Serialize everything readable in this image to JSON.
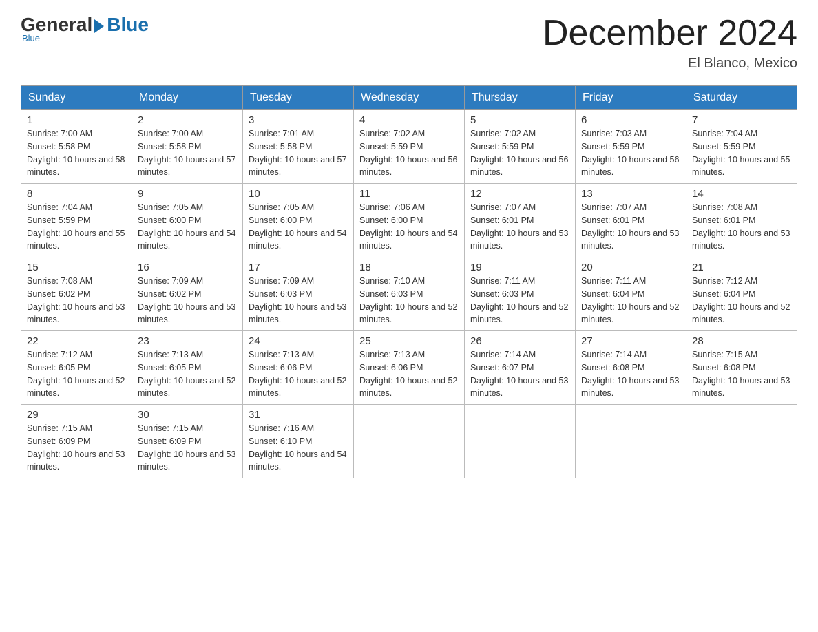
{
  "logo": {
    "general": "General",
    "blue": "Blue",
    "tagline": "Blue"
  },
  "title": {
    "month_year": "December 2024",
    "location": "El Blanco, Mexico"
  },
  "header_days": [
    "Sunday",
    "Monday",
    "Tuesday",
    "Wednesday",
    "Thursday",
    "Friday",
    "Saturday"
  ],
  "weeks": [
    [
      {
        "day": "1",
        "sunrise": "7:00 AM",
        "sunset": "5:58 PM",
        "daylight": "10 hours and 58 minutes."
      },
      {
        "day": "2",
        "sunrise": "7:00 AM",
        "sunset": "5:58 PM",
        "daylight": "10 hours and 57 minutes."
      },
      {
        "day": "3",
        "sunrise": "7:01 AM",
        "sunset": "5:58 PM",
        "daylight": "10 hours and 57 minutes."
      },
      {
        "day": "4",
        "sunrise": "7:02 AM",
        "sunset": "5:59 PM",
        "daylight": "10 hours and 56 minutes."
      },
      {
        "day": "5",
        "sunrise": "7:02 AM",
        "sunset": "5:59 PM",
        "daylight": "10 hours and 56 minutes."
      },
      {
        "day": "6",
        "sunrise": "7:03 AM",
        "sunset": "5:59 PM",
        "daylight": "10 hours and 56 minutes."
      },
      {
        "day": "7",
        "sunrise": "7:04 AM",
        "sunset": "5:59 PM",
        "daylight": "10 hours and 55 minutes."
      }
    ],
    [
      {
        "day": "8",
        "sunrise": "7:04 AM",
        "sunset": "5:59 PM",
        "daylight": "10 hours and 55 minutes."
      },
      {
        "day": "9",
        "sunrise": "7:05 AM",
        "sunset": "6:00 PM",
        "daylight": "10 hours and 54 minutes."
      },
      {
        "day": "10",
        "sunrise": "7:05 AM",
        "sunset": "6:00 PM",
        "daylight": "10 hours and 54 minutes."
      },
      {
        "day": "11",
        "sunrise": "7:06 AM",
        "sunset": "6:00 PM",
        "daylight": "10 hours and 54 minutes."
      },
      {
        "day": "12",
        "sunrise": "7:07 AM",
        "sunset": "6:01 PM",
        "daylight": "10 hours and 53 minutes."
      },
      {
        "day": "13",
        "sunrise": "7:07 AM",
        "sunset": "6:01 PM",
        "daylight": "10 hours and 53 minutes."
      },
      {
        "day": "14",
        "sunrise": "7:08 AM",
        "sunset": "6:01 PM",
        "daylight": "10 hours and 53 minutes."
      }
    ],
    [
      {
        "day": "15",
        "sunrise": "7:08 AM",
        "sunset": "6:02 PM",
        "daylight": "10 hours and 53 minutes."
      },
      {
        "day": "16",
        "sunrise": "7:09 AM",
        "sunset": "6:02 PM",
        "daylight": "10 hours and 53 minutes."
      },
      {
        "day": "17",
        "sunrise": "7:09 AM",
        "sunset": "6:03 PM",
        "daylight": "10 hours and 53 minutes."
      },
      {
        "day": "18",
        "sunrise": "7:10 AM",
        "sunset": "6:03 PM",
        "daylight": "10 hours and 52 minutes."
      },
      {
        "day": "19",
        "sunrise": "7:11 AM",
        "sunset": "6:03 PM",
        "daylight": "10 hours and 52 minutes."
      },
      {
        "day": "20",
        "sunrise": "7:11 AM",
        "sunset": "6:04 PM",
        "daylight": "10 hours and 52 minutes."
      },
      {
        "day": "21",
        "sunrise": "7:12 AM",
        "sunset": "6:04 PM",
        "daylight": "10 hours and 52 minutes."
      }
    ],
    [
      {
        "day": "22",
        "sunrise": "7:12 AM",
        "sunset": "6:05 PM",
        "daylight": "10 hours and 52 minutes."
      },
      {
        "day": "23",
        "sunrise": "7:13 AM",
        "sunset": "6:05 PM",
        "daylight": "10 hours and 52 minutes."
      },
      {
        "day": "24",
        "sunrise": "7:13 AM",
        "sunset": "6:06 PM",
        "daylight": "10 hours and 52 minutes."
      },
      {
        "day": "25",
        "sunrise": "7:13 AM",
        "sunset": "6:06 PM",
        "daylight": "10 hours and 52 minutes."
      },
      {
        "day": "26",
        "sunrise": "7:14 AM",
        "sunset": "6:07 PM",
        "daylight": "10 hours and 53 minutes."
      },
      {
        "day": "27",
        "sunrise": "7:14 AM",
        "sunset": "6:08 PM",
        "daylight": "10 hours and 53 minutes."
      },
      {
        "day": "28",
        "sunrise": "7:15 AM",
        "sunset": "6:08 PM",
        "daylight": "10 hours and 53 minutes."
      }
    ],
    [
      {
        "day": "29",
        "sunrise": "7:15 AM",
        "sunset": "6:09 PM",
        "daylight": "10 hours and 53 minutes."
      },
      {
        "day": "30",
        "sunrise": "7:15 AM",
        "sunset": "6:09 PM",
        "daylight": "10 hours and 53 minutes."
      },
      {
        "day": "31",
        "sunrise": "7:16 AM",
        "sunset": "6:10 PM",
        "daylight": "10 hours and 54 minutes."
      },
      null,
      null,
      null,
      null
    ]
  ]
}
